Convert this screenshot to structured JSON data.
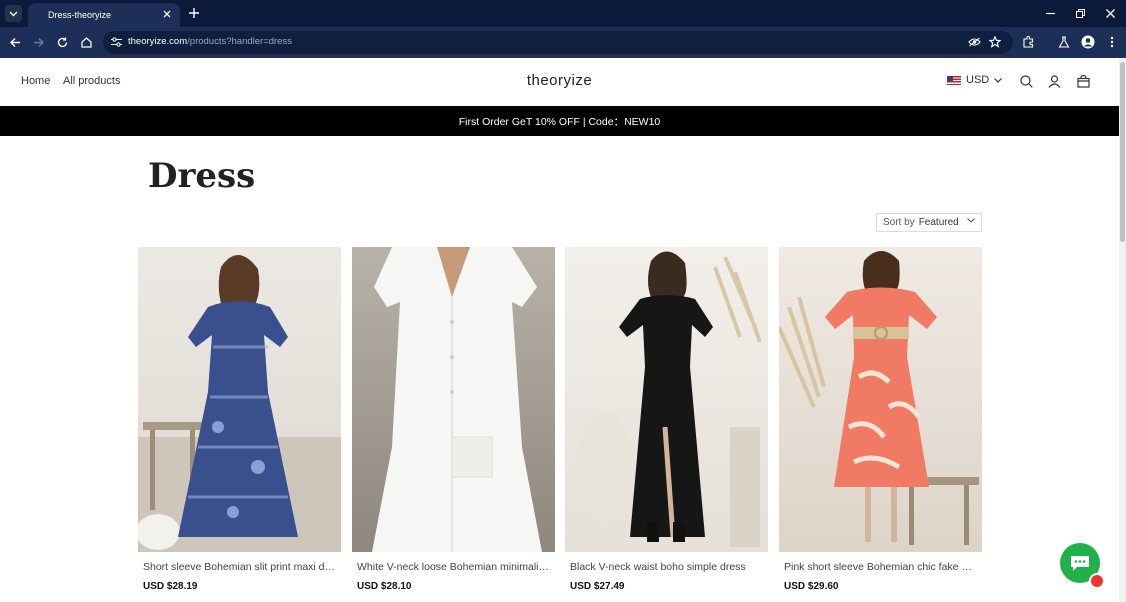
{
  "browser": {
    "tab_title": "Dress-theoryize",
    "url_host": "theoryize.com",
    "url_path": "/products?handler=dress"
  },
  "header": {
    "nav": [
      "Home",
      "All products"
    ],
    "logo": "theoryize",
    "currency": "USD"
  },
  "announcement": "First Order GeT 10% OFF | Code：NEW10",
  "collection": {
    "title": "Dress",
    "sort_label": "Sort by",
    "sort_value": "Featured"
  },
  "products": [
    {
      "title": "Short sleeve Bohemian slit print maxi dress",
      "price": "USD $28.19",
      "color": "#3a4f8e"
    },
    {
      "title": "White V-neck loose Bohemian minimalist dress",
      "price": "USD $28.10",
      "color": "#f3f3f1"
    },
    {
      "title": "Black V-neck waist boho simple dress",
      "price": "USD $27.49",
      "color": "#161616"
    },
    {
      "title": "Pink short sleeve Bohemian chic fake dress",
      "price": "USD $29.60",
      "color": "#f07a64"
    }
  ],
  "colors": {
    "chrome_dark": "#0b1a3a",
    "chrome_toolbar": "#1d2f57",
    "chat_green": "#1fb24a"
  }
}
